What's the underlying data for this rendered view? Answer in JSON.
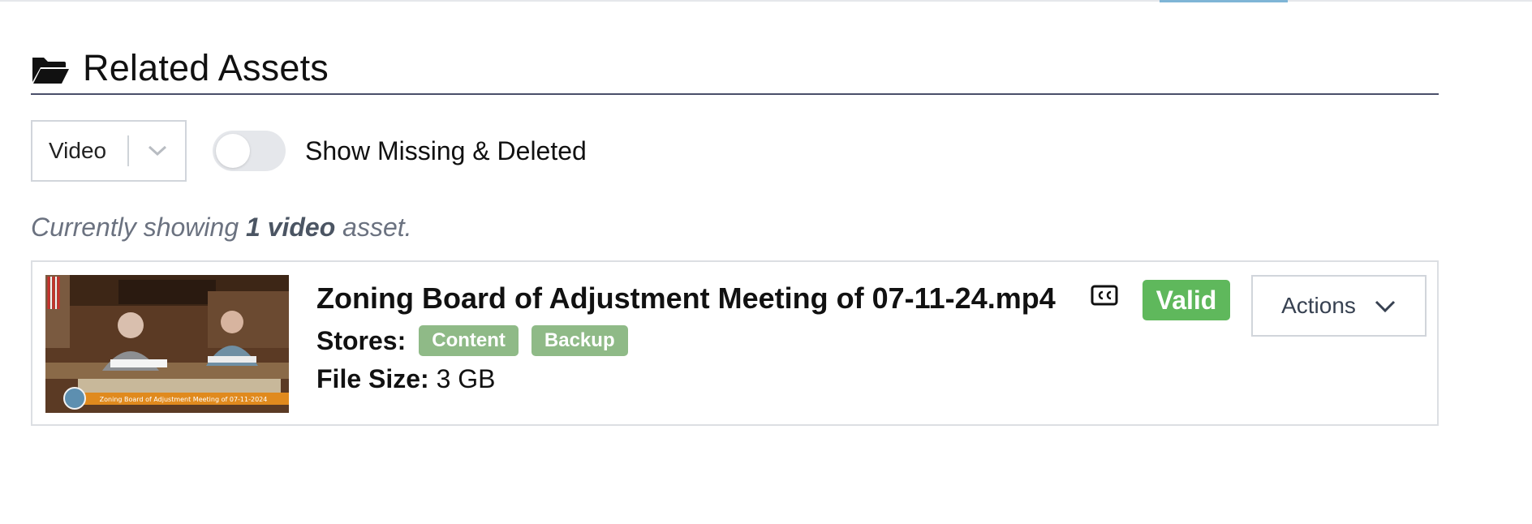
{
  "section": {
    "title": "Related Assets",
    "icon": "folder-open-icon"
  },
  "filters": {
    "asset_type": {
      "selected": "Video"
    },
    "show_missing_toggle": {
      "label": "Show Missing & Deleted",
      "enabled": false
    }
  },
  "summary": {
    "prefix": "Currently showing ",
    "count_text": "1 video",
    "suffix": " asset."
  },
  "assets": [
    {
      "title": "Zoning Board of Adjustment Meeting of 07-11-24.mp4",
      "has_captions": true,
      "status": "Valid",
      "status_color": "#5fb85c",
      "actions_label": "Actions",
      "stores_label": "Stores:",
      "stores": [
        "Content",
        "Backup"
      ],
      "store_color": "#8fba87",
      "file_size_label": "File Size:",
      "file_size": "3 GB",
      "thumbnail_caption": "Zoning Board of Adjustment Meeting of 07-11-2024"
    }
  ],
  "colors": {
    "header_rule": "#4a4f6a",
    "accent_tab": "#7fb5d6",
    "muted_text": "#6b7280"
  }
}
